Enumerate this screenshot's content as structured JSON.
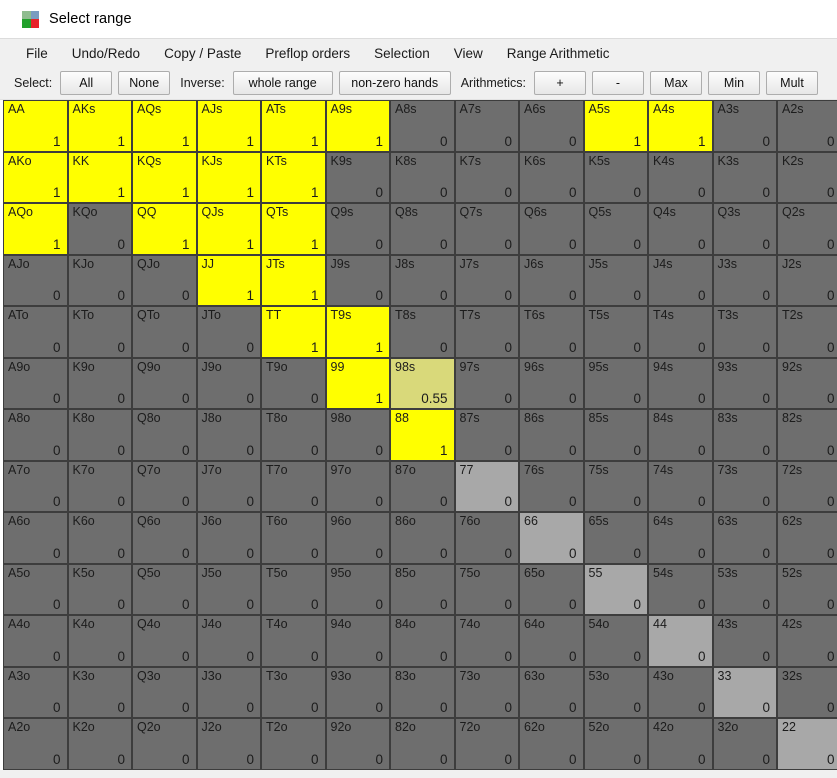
{
  "window": {
    "title": "Select range",
    "icon": "range-grid-icon",
    "icon_colors": [
      "#8fbc8f",
      "#7a9cc0",
      "#22a02c",
      "#e8232a"
    ]
  },
  "menubar": {
    "items": [
      {
        "label": "File",
        "name": "menu-file"
      },
      {
        "label": "Undo/Redo",
        "name": "menu-undo-redo"
      },
      {
        "label": "Copy / Paste",
        "name": "menu-copy-paste"
      },
      {
        "label": "Preflop orders",
        "name": "menu-preflop-orders"
      },
      {
        "label": "Selection",
        "name": "menu-selection"
      },
      {
        "label": "View",
        "name": "menu-view"
      },
      {
        "label": "Range Arithmetic",
        "name": "menu-range-arithmetic"
      }
    ]
  },
  "toolbar": {
    "select_label": "Select:",
    "all_label": "All",
    "none_label": "None",
    "inverse_label": "Inverse:",
    "whole_range_label": "whole range",
    "non_zero_hands_label": "non-zero hands",
    "arithmetics_label": "Arithmetics:",
    "plus_label": "+",
    "minus_label": "-",
    "max_label": "Max",
    "min_label": "Min",
    "mult_label": "Mult"
  },
  "colors": {
    "selected": "#ffff00",
    "partial": "#d9d97a",
    "unselected": "#6e6e6e",
    "pair_unselected": "#a8a8a8"
  },
  "grid": {
    "rows": 13,
    "cols": 13,
    "cells": [
      [
        {
          "label": "AA",
          "value": "1",
          "state": "on"
        },
        {
          "label": "AKs",
          "value": "1",
          "state": "on"
        },
        {
          "label": "AQs",
          "value": "1",
          "state": "on"
        },
        {
          "label": "AJs",
          "value": "1",
          "state": "on"
        },
        {
          "label": "ATs",
          "value": "1",
          "state": "on"
        },
        {
          "label": "A9s",
          "value": "1",
          "state": "on"
        },
        {
          "label": "A8s",
          "value": "0",
          "state": "off"
        },
        {
          "label": "A7s",
          "value": "0",
          "state": "off"
        },
        {
          "label": "A6s",
          "value": "0",
          "state": "off"
        },
        {
          "label": "A5s",
          "value": "1",
          "state": "on"
        },
        {
          "label": "A4s",
          "value": "1",
          "state": "on"
        },
        {
          "label": "A3s",
          "value": "0",
          "state": "off"
        },
        {
          "label": "A2s",
          "value": "0",
          "state": "off"
        }
      ],
      [
        {
          "label": "AKo",
          "value": "1",
          "state": "on"
        },
        {
          "label": "KK",
          "value": "1",
          "state": "on"
        },
        {
          "label": "KQs",
          "value": "1",
          "state": "on"
        },
        {
          "label": "KJs",
          "value": "1",
          "state": "on"
        },
        {
          "label": "KTs",
          "value": "1",
          "state": "on"
        },
        {
          "label": "K9s",
          "value": "0",
          "state": "off"
        },
        {
          "label": "K8s",
          "value": "0",
          "state": "off"
        },
        {
          "label": "K7s",
          "value": "0",
          "state": "off"
        },
        {
          "label": "K6s",
          "value": "0",
          "state": "off"
        },
        {
          "label": "K5s",
          "value": "0",
          "state": "off"
        },
        {
          "label": "K4s",
          "value": "0",
          "state": "off"
        },
        {
          "label": "K3s",
          "value": "0",
          "state": "off"
        },
        {
          "label": "K2s",
          "value": "0",
          "state": "off"
        }
      ],
      [
        {
          "label": "AQo",
          "value": "1",
          "state": "on"
        },
        {
          "label": "KQo",
          "value": "0",
          "state": "off"
        },
        {
          "label": "QQ",
          "value": "1",
          "state": "on"
        },
        {
          "label": "QJs",
          "value": "1",
          "state": "on"
        },
        {
          "label": "QTs",
          "value": "1",
          "state": "on"
        },
        {
          "label": "Q9s",
          "value": "0",
          "state": "off"
        },
        {
          "label": "Q8s",
          "value": "0",
          "state": "off"
        },
        {
          "label": "Q7s",
          "value": "0",
          "state": "off"
        },
        {
          "label": "Q6s",
          "value": "0",
          "state": "off"
        },
        {
          "label": "Q5s",
          "value": "0",
          "state": "off"
        },
        {
          "label": "Q4s",
          "value": "0",
          "state": "off"
        },
        {
          "label": "Q3s",
          "value": "0",
          "state": "off"
        },
        {
          "label": "Q2s",
          "value": "0",
          "state": "off"
        }
      ],
      [
        {
          "label": "AJo",
          "value": "0",
          "state": "off"
        },
        {
          "label": "KJo",
          "value": "0",
          "state": "off"
        },
        {
          "label": "QJo",
          "value": "0",
          "state": "off"
        },
        {
          "label": "JJ",
          "value": "1",
          "state": "on"
        },
        {
          "label": "JTs",
          "value": "1",
          "state": "on"
        },
        {
          "label": "J9s",
          "value": "0",
          "state": "off"
        },
        {
          "label": "J8s",
          "value": "0",
          "state": "off"
        },
        {
          "label": "J7s",
          "value": "0",
          "state": "off"
        },
        {
          "label": "J6s",
          "value": "0",
          "state": "off"
        },
        {
          "label": "J5s",
          "value": "0",
          "state": "off"
        },
        {
          "label": "J4s",
          "value": "0",
          "state": "off"
        },
        {
          "label": "J3s",
          "value": "0",
          "state": "off"
        },
        {
          "label": "J2s",
          "value": "0",
          "state": "off"
        }
      ],
      [
        {
          "label": "ATo",
          "value": "0",
          "state": "off"
        },
        {
          "label": "KTo",
          "value": "0",
          "state": "off"
        },
        {
          "label": "QTo",
          "value": "0",
          "state": "off"
        },
        {
          "label": "JTo",
          "value": "0",
          "state": "off"
        },
        {
          "label": "TT",
          "value": "1",
          "state": "on"
        },
        {
          "label": "T9s",
          "value": "1",
          "state": "on"
        },
        {
          "label": "T8s",
          "value": "0",
          "state": "off"
        },
        {
          "label": "T7s",
          "value": "0",
          "state": "off"
        },
        {
          "label": "T6s",
          "value": "0",
          "state": "off"
        },
        {
          "label": "T5s",
          "value": "0",
          "state": "off"
        },
        {
          "label": "T4s",
          "value": "0",
          "state": "off"
        },
        {
          "label": "T3s",
          "value": "0",
          "state": "off"
        },
        {
          "label": "T2s",
          "value": "0",
          "state": "off"
        }
      ],
      [
        {
          "label": "A9o",
          "value": "0",
          "state": "off"
        },
        {
          "label": "K9o",
          "value": "0",
          "state": "off"
        },
        {
          "label": "Q9o",
          "value": "0",
          "state": "off"
        },
        {
          "label": "J9o",
          "value": "0",
          "state": "off"
        },
        {
          "label": "T9o",
          "value": "0",
          "state": "off"
        },
        {
          "label": "99",
          "value": "1",
          "state": "on"
        },
        {
          "label": "98s",
          "value": "0.55",
          "state": "partial"
        },
        {
          "label": "97s",
          "value": "0",
          "state": "off"
        },
        {
          "label": "96s",
          "value": "0",
          "state": "off"
        },
        {
          "label": "95s",
          "value": "0",
          "state": "off"
        },
        {
          "label": "94s",
          "value": "0",
          "state": "off"
        },
        {
          "label": "93s",
          "value": "0",
          "state": "off"
        },
        {
          "label": "92s",
          "value": "0",
          "state": "off"
        }
      ],
      [
        {
          "label": "A8o",
          "value": "0",
          "state": "off"
        },
        {
          "label": "K8o",
          "value": "0",
          "state": "off"
        },
        {
          "label": "Q8o",
          "value": "0",
          "state": "off"
        },
        {
          "label": "J8o",
          "value": "0",
          "state": "off"
        },
        {
          "label": "T8o",
          "value": "0",
          "state": "off"
        },
        {
          "label": "98o",
          "value": "0",
          "state": "off"
        },
        {
          "label": "88",
          "value": "1",
          "state": "on"
        },
        {
          "label": "87s",
          "value": "0",
          "state": "off"
        },
        {
          "label": "86s",
          "value": "0",
          "state": "off"
        },
        {
          "label": "85s",
          "value": "0",
          "state": "off"
        },
        {
          "label": "84s",
          "value": "0",
          "state": "off"
        },
        {
          "label": "83s",
          "value": "0",
          "state": "off"
        },
        {
          "label": "82s",
          "value": "0",
          "state": "off"
        }
      ],
      [
        {
          "label": "A7o",
          "value": "0",
          "state": "off"
        },
        {
          "label": "K7o",
          "value": "0",
          "state": "off"
        },
        {
          "label": "Q7o",
          "value": "0",
          "state": "off"
        },
        {
          "label": "J7o",
          "value": "0",
          "state": "off"
        },
        {
          "label": "T7o",
          "value": "0",
          "state": "off"
        },
        {
          "label": "97o",
          "value": "0",
          "state": "off"
        },
        {
          "label": "87o",
          "value": "0",
          "state": "off"
        },
        {
          "label": "77",
          "value": "0",
          "state": "pair"
        },
        {
          "label": "76s",
          "value": "0",
          "state": "off"
        },
        {
          "label": "75s",
          "value": "0",
          "state": "off"
        },
        {
          "label": "74s",
          "value": "0",
          "state": "off"
        },
        {
          "label": "73s",
          "value": "0",
          "state": "off"
        },
        {
          "label": "72s",
          "value": "0",
          "state": "off"
        }
      ],
      [
        {
          "label": "A6o",
          "value": "0",
          "state": "off"
        },
        {
          "label": "K6o",
          "value": "0",
          "state": "off"
        },
        {
          "label": "Q6o",
          "value": "0",
          "state": "off"
        },
        {
          "label": "J6o",
          "value": "0",
          "state": "off"
        },
        {
          "label": "T6o",
          "value": "0",
          "state": "off"
        },
        {
          "label": "96o",
          "value": "0",
          "state": "off"
        },
        {
          "label": "86o",
          "value": "0",
          "state": "off"
        },
        {
          "label": "76o",
          "value": "0",
          "state": "off"
        },
        {
          "label": "66",
          "value": "0",
          "state": "pair"
        },
        {
          "label": "65s",
          "value": "0",
          "state": "off"
        },
        {
          "label": "64s",
          "value": "0",
          "state": "off"
        },
        {
          "label": "63s",
          "value": "0",
          "state": "off"
        },
        {
          "label": "62s",
          "value": "0",
          "state": "off"
        }
      ],
      [
        {
          "label": "A5o",
          "value": "0",
          "state": "off"
        },
        {
          "label": "K5o",
          "value": "0",
          "state": "off"
        },
        {
          "label": "Q5o",
          "value": "0",
          "state": "off"
        },
        {
          "label": "J5o",
          "value": "0",
          "state": "off"
        },
        {
          "label": "T5o",
          "value": "0",
          "state": "off"
        },
        {
          "label": "95o",
          "value": "0",
          "state": "off"
        },
        {
          "label": "85o",
          "value": "0",
          "state": "off"
        },
        {
          "label": "75o",
          "value": "0",
          "state": "off"
        },
        {
          "label": "65o",
          "value": "0",
          "state": "off"
        },
        {
          "label": "55",
          "value": "0",
          "state": "pair"
        },
        {
          "label": "54s",
          "value": "0",
          "state": "off"
        },
        {
          "label": "53s",
          "value": "0",
          "state": "off"
        },
        {
          "label": "52s",
          "value": "0",
          "state": "off"
        }
      ],
      [
        {
          "label": "A4o",
          "value": "0",
          "state": "off"
        },
        {
          "label": "K4o",
          "value": "0",
          "state": "off"
        },
        {
          "label": "Q4o",
          "value": "0",
          "state": "off"
        },
        {
          "label": "J4o",
          "value": "0",
          "state": "off"
        },
        {
          "label": "T4o",
          "value": "0",
          "state": "off"
        },
        {
          "label": "94o",
          "value": "0",
          "state": "off"
        },
        {
          "label": "84o",
          "value": "0",
          "state": "off"
        },
        {
          "label": "74o",
          "value": "0",
          "state": "off"
        },
        {
          "label": "64o",
          "value": "0",
          "state": "off"
        },
        {
          "label": "54o",
          "value": "0",
          "state": "off"
        },
        {
          "label": "44",
          "value": "0",
          "state": "pair"
        },
        {
          "label": "43s",
          "value": "0",
          "state": "off"
        },
        {
          "label": "42s",
          "value": "0",
          "state": "off"
        }
      ],
      [
        {
          "label": "A3o",
          "value": "0",
          "state": "off"
        },
        {
          "label": "K3o",
          "value": "0",
          "state": "off"
        },
        {
          "label": "Q3o",
          "value": "0",
          "state": "off"
        },
        {
          "label": "J3o",
          "value": "0",
          "state": "off"
        },
        {
          "label": "T3o",
          "value": "0",
          "state": "off"
        },
        {
          "label": "93o",
          "value": "0",
          "state": "off"
        },
        {
          "label": "83o",
          "value": "0",
          "state": "off"
        },
        {
          "label": "73o",
          "value": "0",
          "state": "off"
        },
        {
          "label": "63o",
          "value": "0",
          "state": "off"
        },
        {
          "label": "53o",
          "value": "0",
          "state": "off"
        },
        {
          "label": "43o",
          "value": "0",
          "state": "off"
        },
        {
          "label": "33",
          "value": "0",
          "state": "pair"
        },
        {
          "label": "32s",
          "value": "0",
          "state": "off"
        }
      ],
      [
        {
          "label": "A2o",
          "value": "0",
          "state": "off"
        },
        {
          "label": "K2o",
          "value": "0",
          "state": "off"
        },
        {
          "label": "Q2o",
          "value": "0",
          "state": "off"
        },
        {
          "label": "J2o",
          "value": "0",
          "state": "off"
        },
        {
          "label": "T2o",
          "value": "0",
          "state": "off"
        },
        {
          "label": "92o",
          "value": "0",
          "state": "off"
        },
        {
          "label": "82o",
          "value": "0",
          "state": "off"
        },
        {
          "label": "72o",
          "value": "0",
          "state": "off"
        },
        {
          "label": "62o",
          "value": "0",
          "state": "off"
        },
        {
          "label": "52o",
          "value": "0",
          "state": "off"
        },
        {
          "label": "42o",
          "value": "0",
          "state": "off"
        },
        {
          "label": "32o",
          "value": "0",
          "state": "off"
        },
        {
          "label": "22",
          "value": "0",
          "state": "pair"
        }
      ]
    ]
  }
}
